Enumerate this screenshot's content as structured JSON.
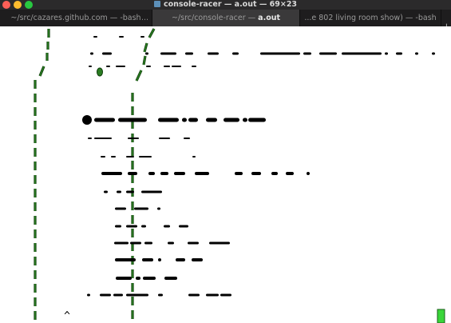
{
  "window": {
    "title": "console-racer — a.out — 69×23"
  },
  "tabs": [
    {
      "prefix": "",
      "label": "~/src/cazares.github.com — -bash",
      "more": "..."
    },
    {
      "prefix": "~/src/console-racer — ",
      "label": "a.out"
    },
    {
      "prefix": "",
      "label": "...e 802 living room show) — -bash"
    }
  ],
  "add_tab_label": "+",
  "game": {
    "title": "console-racer",
    "player_glyph": "^",
    "colors": {
      "lane": "#2a7d22",
      "lane_outline": "#0f3d0b",
      "text": "#000000",
      "fuel": "#3ad63a"
    }
  }
}
